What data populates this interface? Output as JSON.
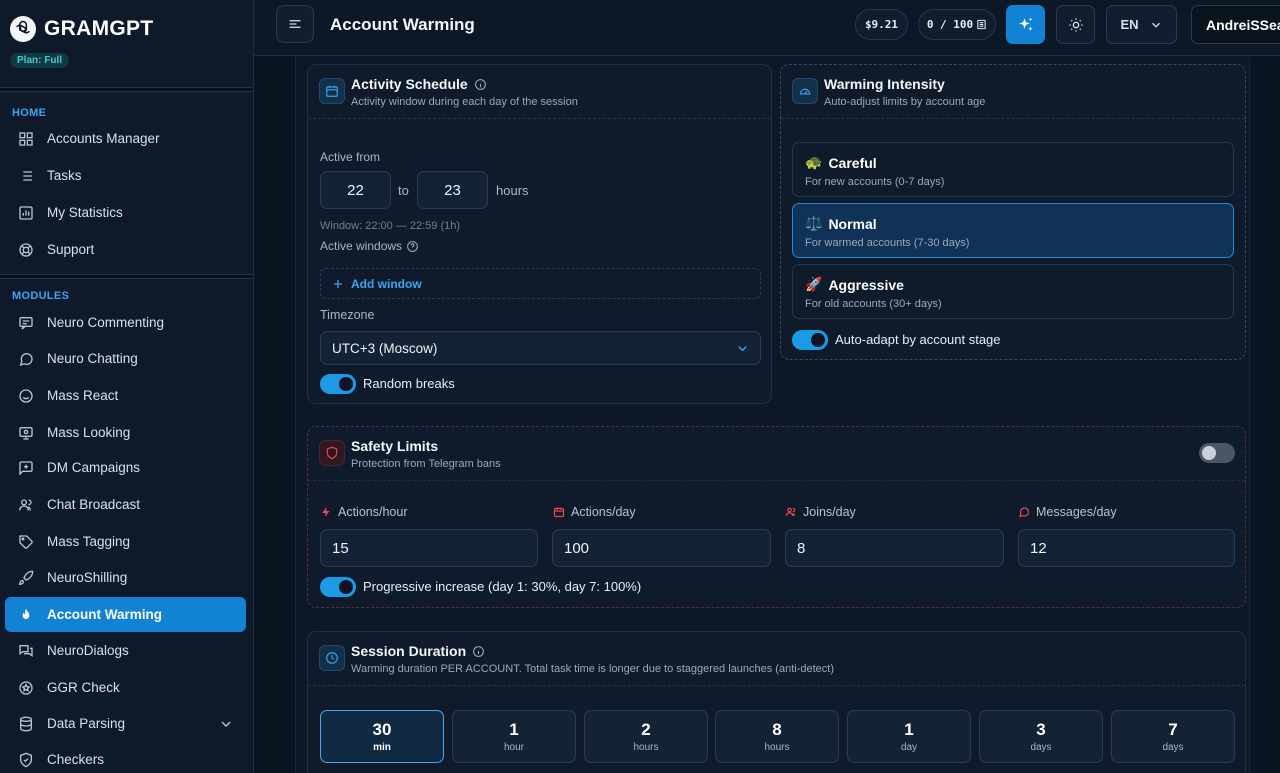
{
  "brand": {
    "name": "GRAMGPT",
    "plan": "Plan: Full"
  },
  "sidebar": {
    "home_label": "HOME",
    "home_items": [
      {
        "label": "Accounts Manager",
        "icon": "grid-icon"
      },
      {
        "label": "Tasks",
        "icon": "list-icon"
      },
      {
        "label": "My Statistics",
        "icon": "bar-chart-icon"
      },
      {
        "label": "Support",
        "icon": "lifebuoy-icon"
      }
    ],
    "modules_label": "MODULES",
    "module_items": [
      {
        "label": "Neuro Commenting",
        "icon": "comment-icon"
      },
      {
        "label": "Neuro Chatting",
        "icon": "chat-bubble-icon"
      },
      {
        "label": "Mass React",
        "icon": "smile-icon"
      },
      {
        "label": "Mass Looking",
        "icon": "monitor-eye-icon"
      },
      {
        "label": "DM Campaigns",
        "icon": "message-plus-icon"
      },
      {
        "label": "Chat Broadcast",
        "icon": "users-icon"
      },
      {
        "label": "Mass Tagging",
        "icon": "tag-icon"
      },
      {
        "label": "NeuroShilling",
        "icon": "rocket-icon"
      },
      {
        "label": "Account Warming",
        "icon": "flame-icon",
        "active": true
      },
      {
        "label": "NeuroDialogs",
        "icon": "dialogs-icon"
      },
      {
        "label": "GGR Check",
        "icon": "star-circle-icon"
      },
      {
        "label": "Data Parsing",
        "icon": "database-icon"
      },
      {
        "label": "Checkers",
        "icon": "shield-check-icon"
      }
    ]
  },
  "header": {
    "title": "Account Warming",
    "balance": "$9.21",
    "quota": "0 / 100",
    "language": "EN",
    "user": "AndreiSSea"
  },
  "schedule": {
    "title": "Activity Schedule",
    "subtitle": "Activity window during each day of the session",
    "active_from_label": "Active from",
    "from": "22",
    "to_label": "to",
    "to": "23",
    "hours_label": "hours",
    "window_info": "Window: 22:00 — 22:59 (1h)",
    "active_windows_label": "Active windows",
    "add_window_label": "Add window",
    "timezone_label": "Timezone",
    "timezone_value": "UTC+3 (Moscow)",
    "random_breaks_label": "Random breaks",
    "random_breaks_on": true
  },
  "intensity": {
    "title": "Warming Intensity",
    "subtitle": "Auto-adjust limits by account age",
    "options": [
      {
        "emoji": "🐢",
        "name": "Careful",
        "desc": "For new accounts (0-7 days)"
      },
      {
        "emoji": "⚖️",
        "name": "Normal",
        "desc": "For warmed accounts (7-30 days)",
        "selected": true
      },
      {
        "emoji": "🚀",
        "name": "Aggressive",
        "desc": "For old accounts (30+ days)"
      }
    ],
    "auto_adapt_label": "Auto-adapt by account stage",
    "auto_adapt_on": true
  },
  "safety": {
    "title": "Safety Limits",
    "subtitle": "Protection from Telegram bans",
    "enabled": false,
    "limits": [
      {
        "label": "Actions/hour",
        "value": "15",
        "icon": "bolt-icon"
      },
      {
        "label": "Actions/day",
        "value": "100",
        "icon": "calendar-icon"
      },
      {
        "label": "Joins/day",
        "value": "8",
        "icon": "users-icon"
      },
      {
        "label": "Messages/day",
        "value": "12",
        "icon": "message-icon"
      }
    ],
    "progressive_label": "Progressive increase (day 1: 30%, day 7: 100%)",
    "progressive_on": true
  },
  "session": {
    "title": "Session Duration",
    "subtitle": "Warming duration PER ACCOUNT. Total task time is longer due to staggered launches (anti-detect)",
    "options": [
      {
        "value": "30",
        "unit": "min",
        "selected": true
      },
      {
        "value": "1",
        "unit": "hour"
      },
      {
        "value": "2",
        "unit": "hours"
      },
      {
        "value": "8",
        "unit": "hours"
      },
      {
        "value": "1",
        "unit": "day"
      },
      {
        "value": "3",
        "unit": "days"
      },
      {
        "value": "7",
        "unit": "days"
      }
    ]
  },
  "colors": {
    "accent": "#1283d4",
    "background": "#0b1420",
    "danger": "#e5484d"
  }
}
